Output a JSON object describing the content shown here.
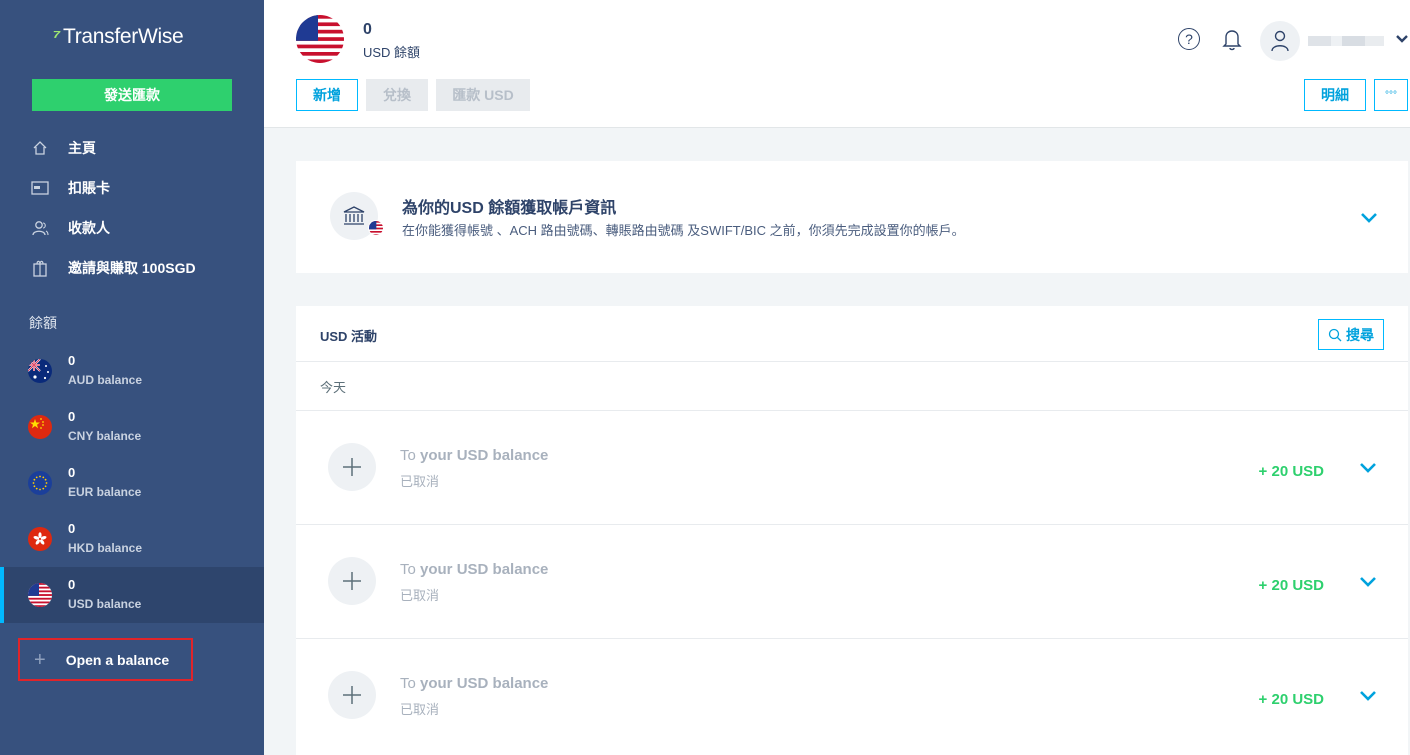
{
  "sidebar": {
    "logo": "TransferWise",
    "send_button": "發送匯款",
    "nav": [
      {
        "label": "主頁",
        "icon": "home-icon"
      },
      {
        "label": "扣賬卡",
        "icon": "card-icon"
      },
      {
        "label": "收款人",
        "icon": "recipients-icon"
      },
      {
        "label": "邀請與賺取 100SGD",
        "icon": "gift-icon"
      }
    ],
    "balances_label": "餘額",
    "balances": [
      {
        "amount": "0",
        "label": "AUD balance",
        "flag": "au-flag-icon"
      },
      {
        "amount": "0",
        "label": "CNY balance",
        "flag": "cn-flag-icon"
      },
      {
        "amount": "0",
        "label": "EUR balance",
        "flag": "eu-flag-icon"
      },
      {
        "amount": "0",
        "label": "HKD balance",
        "flag": "hk-flag-icon"
      },
      {
        "amount": "0",
        "label": "USD balance",
        "flag": "us-flag-icon",
        "active": true
      }
    ],
    "open_balance": "Open a balance"
  },
  "header": {
    "amount": "0",
    "subtitle": "USD 餘額",
    "buttons": {
      "add": "新增",
      "convert": "兌換",
      "send": "匯款 USD",
      "details": "明細",
      "more": "°°°"
    },
    "help": "?"
  },
  "account_info": {
    "title": "為你的USD 餘額獲取帳戶資訊",
    "description": "在你能獲得帳號 、ACH 路由號碼、轉賬路由號碼 及SWIFT/BIC 之前，你須先完成設置你的帳戶。"
  },
  "activity": {
    "title": "USD 活動",
    "search": "搜尋",
    "date_group": "今天",
    "items": [
      {
        "prefix": "To ",
        "title": "your USD balance",
        "status": "已取消",
        "amount": "+ 20 USD"
      },
      {
        "prefix": "To ",
        "title": "your USD balance",
        "status": "已取消",
        "amount": "+ 20 USD"
      },
      {
        "prefix": "To ",
        "title": "your USD balance",
        "status": "已取消",
        "amount": "+ 20 USD"
      }
    ]
  },
  "colors": {
    "sidebar": "#37517e",
    "accent": "#00b9ff",
    "green": "#2ed06e",
    "highlight": "#e0242a"
  }
}
